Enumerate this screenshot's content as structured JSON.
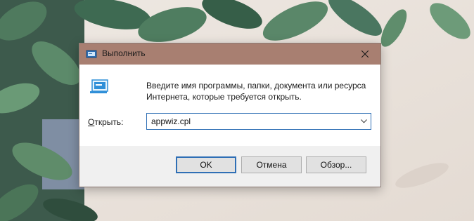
{
  "window": {
    "title": "Выполнить",
    "titlebar_color": "#a87f71",
    "icon": "run-dialog-icon"
  },
  "dialog": {
    "description_line1": "Введите имя программы, папки, документа или ресурса",
    "description_line2": "Интернета, которые требуется открыть.",
    "open_label": "Открыть:",
    "open_label_mnemonic": "О",
    "open_label_rest": "ткрыть:",
    "input_value": "appwiz.cpl",
    "accent_color": "#2f6fb5"
  },
  "buttons": {
    "ok": "OK",
    "cancel": "Отмена",
    "browse": "Обзор..."
  },
  "background": {
    "description": "leaves-wallpaper"
  }
}
